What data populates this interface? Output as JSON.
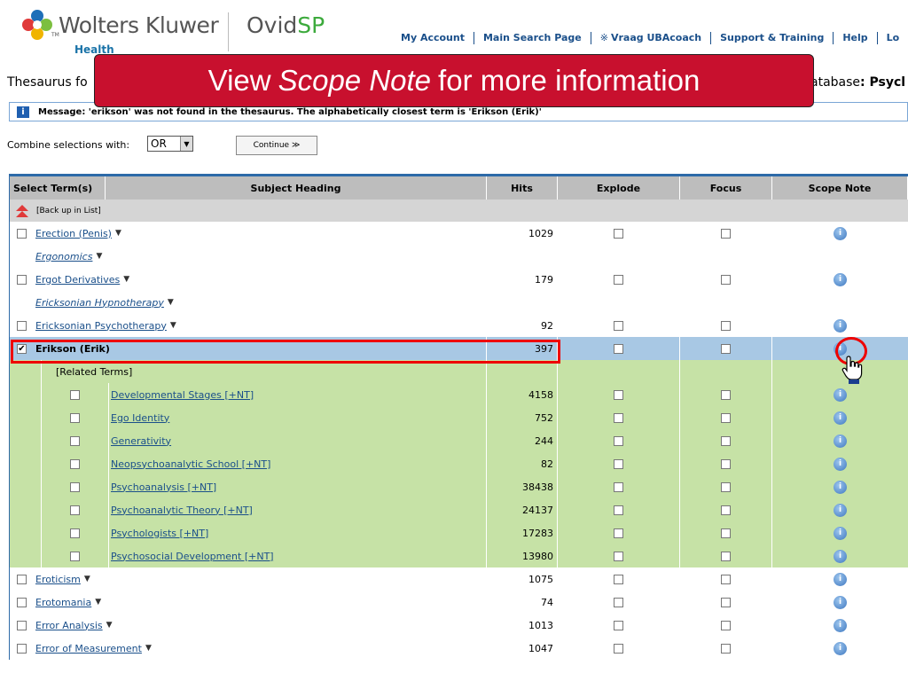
{
  "header": {
    "brand": "Wolters Kluwer",
    "brand_sub": "Health",
    "brand_tm": "TM",
    "product_prefix": "Ovid",
    "product_suffix": "SP",
    "nav": [
      "My Account",
      "Main Search Page",
      "Vraag UBAcoach",
      "Support & Training",
      "Help",
      "Lo"
    ],
    "nav_help_icon": "user-help-icon"
  },
  "page": {
    "title_visible": "Thesaurus fo",
    "database_prefix": "atabase",
    "database_name": ": Psycl"
  },
  "message": {
    "icon": "i",
    "text": "Message: 'erikson' was not found in the thesaurus. The alphabetically closest term is 'Erikson (Erik)'"
  },
  "combine": {
    "label": "Combine selections with:",
    "value": "OR",
    "continue_label": "Continue ≫"
  },
  "table": {
    "headers": {
      "select": "Select Term(s)",
      "subject": "Subject Heading",
      "hits": "Hits",
      "explode": "Explode",
      "focus": "Focus",
      "scope": "Scope Note"
    },
    "back_up": "[Back up in List]",
    "rows": [
      {
        "term": "Erection (Penis)",
        "hits": "1029"
      },
      {
        "term": "Ergonomics"
      },
      {
        "term": "Ergot Derivatives",
        "hits": "179"
      },
      {
        "term": "Ericksonian Hypnotherapy"
      },
      {
        "term": "Ericksonian Psychotherapy",
        "hits": "92"
      },
      {
        "term": "Erikson (Erik)",
        "hits": "397",
        "checked": true
      }
    ],
    "related_label": "[Related Terms]",
    "related": [
      {
        "term": "Developmental Stages [+NT]",
        "hits": "4158"
      },
      {
        "term": "Ego Identity",
        "hits": "752"
      },
      {
        "term": "Generativity",
        "hits": "244"
      },
      {
        "term": "Neopsychoanalytic School [+NT]",
        "hits": "82"
      },
      {
        "term": "Psychoanalysis [+NT]",
        "hits": "38438"
      },
      {
        "term": "Psychoanalytic Theory [+NT]",
        "hits": "24137"
      },
      {
        "term": "Psychologists [+NT]",
        "hits": "17283"
      },
      {
        "term": "Psychosocial Development [+NT]",
        "hits": "13980"
      }
    ],
    "after": [
      {
        "term": "Eroticism",
        "hits": "1075"
      },
      {
        "term": "Erotomania",
        "hits": "74"
      },
      {
        "term": "Error Analysis",
        "hits": "1013"
      },
      {
        "term": "Error of Measurement",
        "hits": "1047"
      }
    ],
    "info_glyph": "i",
    "expand_glyph": "▼"
  },
  "callout": {
    "pre": "View",
    "em": "Scope Note",
    "post": "for more information"
  },
  "colors": {
    "callout_bg": "#c8102e",
    "selected_row": "#a8c8e4",
    "related_row": "#c6e2a6",
    "highlight": "#e00000"
  }
}
